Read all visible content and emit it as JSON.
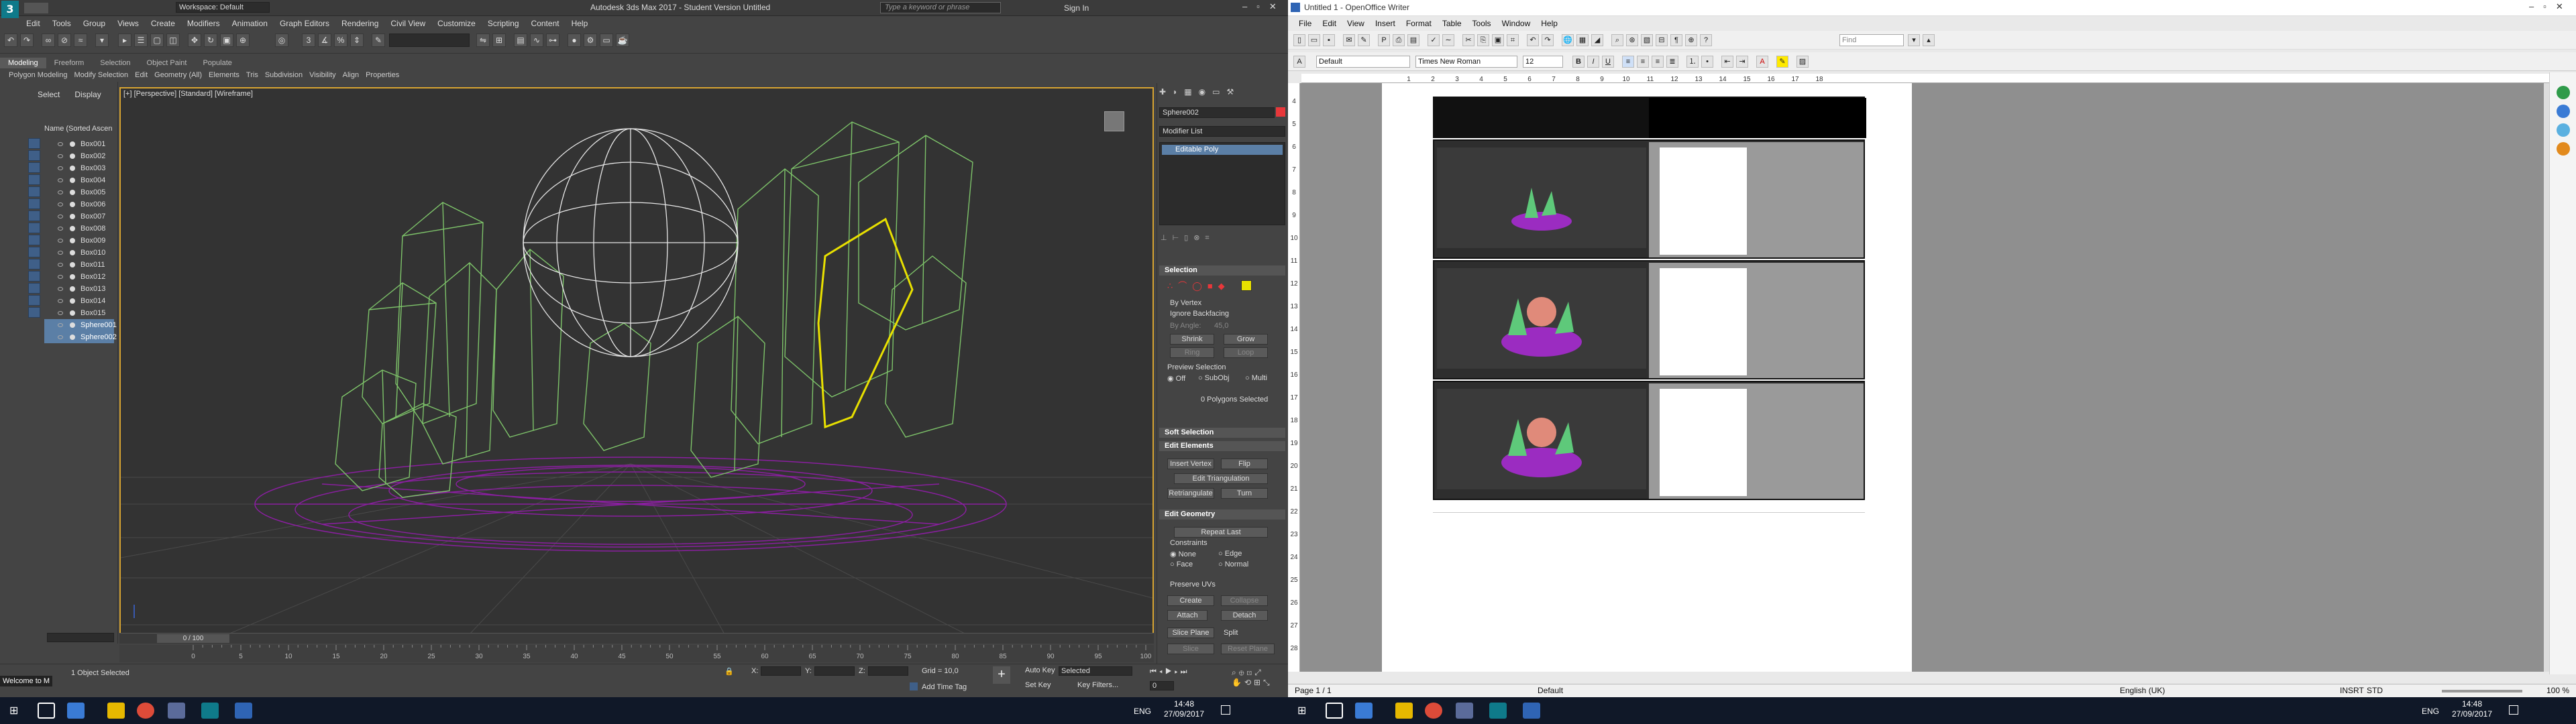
{
  "max": {
    "workspace": "Workspace: Default",
    "title": "Autodesk 3ds Max 2017 - Student Version    Untitled",
    "search_placeholder": "Type a keyword or phrase",
    "sign_in": "Sign In",
    "menu": [
      "Edit",
      "Tools",
      "Group",
      "Views",
      "Create",
      "Modifiers",
      "Animation",
      "Graph Editors",
      "Rendering",
      "Civil View",
      "Customize",
      "Scripting",
      "Content",
      "Help"
    ],
    "ribbon_tabs": [
      "Modeling",
      "Freeform",
      "Selection",
      "Object Paint",
      "Populate"
    ],
    "ribbon_sub": [
      "Polygon Modeling",
      "Modify Selection",
      "Edit",
      "Geometry (All)",
      "Elements",
      "Tris",
      "Subdivision",
      "Visibility",
      "Align",
      "Properties"
    ],
    "explorer_tabs": [
      "Select",
      "Display"
    ],
    "explorer_header": "Name (Sorted Ascen",
    "objects": [
      "Box001",
      "Box002",
      "Box003",
      "Box004",
      "Box005",
      "Box006",
      "Box007",
      "Box008",
      "Box009",
      "Box010",
      "Box011",
      "Box012",
      "Box013",
      "Box014",
      "Box015",
      "Sphere001",
      "Sphere002"
    ],
    "selected_objects": [
      "Sphere001",
      "Sphere002"
    ],
    "viewport_label": "[+] [Perspective] [Standard] [Wireframe]",
    "time_slider": "0 / 100",
    "timeline_ticks": [
      "0",
      "5",
      "10",
      "15",
      "20",
      "25",
      "30",
      "35",
      "40",
      "45",
      "50",
      "55",
      "60",
      "65",
      "70",
      "75",
      "80",
      "85",
      "90",
      "95",
      "100"
    ],
    "status_maxscript": "Welcome to M",
    "status_selected": "1 Object Selected",
    "grid": "Grid = 10,0",
    "add_time_tag": "Add Time Tag",
    "auto_key": "Auto Key",
    "set_key": "Set Key",
    "selected_dropdown": "Selected",
    "key_filters": "Key Filters...",
    "frame_field": "0",
    "coord_x": "X:",
    "coord_y": "Y:",
    "coord_z": "Z:"
  },
  "cmd": {
    "object_name": "Sphere002",
    "modifier_list": "Modifier List",
    "stack_item": "Editable Poly",
    "selection_title": "Selection",
    "by_vertex": "By Vertex",
    "ignore_backfacing": "Ignore Backfacing",
    "by_angle": "By Angle:",
    "by_angle_value": "45,0",
    "shrink": "Shrink",
    "grow": "Grow",
    "ring": "Ring",
    "loop": "Loop",
    "preview_selection": "Preview Selection",
    "preview_off": "Off",
    "preview_subobj": "SubObj",
    "preview_multi": "Multi",
    "polys_selected": "0 Polygons Selected",
    "soft_selection": "Soft Selection",
    "edit_elements": "Edit Elements",
    "insert_vertex": "Insert Vertex",
    "flip": "Flip",
    "edit_triangulation": "Edit Triangulation",
    "retriangulate": "Retriangulate",
    "turn": "Turn",
    "edit_geometry": "Edit Geometry",
    "repeat_last": "Repeat Last",
    "constraints": "Constraints",
    "c_none": "None",
    "c_edge": "Edge",
    "c_face": "Face",
    "c_normal": "Normal",
    "preserve_uvs": "Preserve UVs",
    "create": "Create",
    "collapse": "Collapse",
    "attach": "Attach",
    "detach": "Detach",
    "slice_plane": "Slice Plane",
    "split": "Split",
    "slice": "Slice",
    "reset_plane": "Reset Plane"
  },
  "writer": {
    "title": "Untitled 1 - OpenOffice Writer",
    "menu": [
      "File",
      "Edit",
      "View",
      "Insert",
      "Format",
      "Table",
      "Tools",
      "Window",
      "Help"
    ],
    "find_placeholder": "Find",
    "style": "Default",
    "font": "Times New Roman",
    "size": "12",
    "ruler": [
      "1",
      "2",
      "3",
      "4",
      "5",
      "6",
      "7",
      "8",
      "9",
      "10",
      "11",
      "12",
      "13",
      "14",
      "15",
      "16",
      "17",
      "18"
    ],
    "vruler": [
      "4",
      "5",
      "6",
      "7",
      "8",
      "9",
      "10",
      "11",
      "12",
      "13",
      "14",
      "15",
      "16",
      "17",
      "18",
      "19",
      "20",
      "21",
      "22",
      "23",
      "24",
      "25",
      "26",
      "27",
      "28"
    ],
    "status_page": "Page 1 / 1",
    "status_style": "Default",
    "status_lang": "English (UK)",
    "status_insrt": "INSRT",
    "status_std": "STD",
    "status_zoom": "100 %"
  },
  "taskbar": {
    "time": "14:48",
    "date": "27/09/2017",
    "lang": "ENG"
  },
  "colors": {
    "selection_highlight": "#d7a431",
    "selected_poly": "#e8e000",
    "crystal_wire": "#7ec46a",
    "sphere_wire": "#e8e8e8",
    "base_wire": "#8a1fa0",
    "writer_accent": "#2f64b4"
  }
}
